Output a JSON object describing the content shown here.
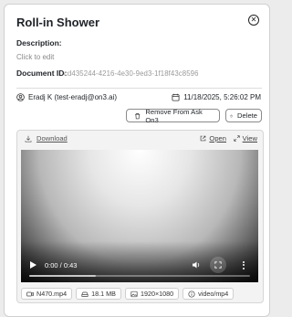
{
  "panel": {
    "title": "Roll-in Shower",
    "description_label": "Description:",
    "description_value": "Click to edit",
    "document_id_label": "Document ID:",
    "document_id_value": "cd435244-4216-4e30-9ed3-1f18f43c8596",
    "user": "Eradj K (test-eradj@on3.ai)",
    "datetime": "11/18/2025, 5:26:02 PM"
  },
  "actions": {
    "remove_label": "Remove From Ask On3",
    "delete_label": "Delete"
  },
  "media": {
    "download_label": "Download",
    "open_label": "Open",
    "view_label": "View",
    "time_display": "0:00 / 0:43",
    "playback_progress": 0.3,
    "file_name": "N470.mp4",
    "file_size": "18.1 MB",
    "resolution": "1920×1080",
    "mime_type": "video/mp4"
  },
  "icons": {
    "close": "close-circle-icon",
    "user": "user-circle-icon",
    "calendar": "calendar-icon",
    "trash": "trash-icon",
    "download": "download-icon",
    "open": "external-link-icon",
    "view": "expand-icon"
  }
}
